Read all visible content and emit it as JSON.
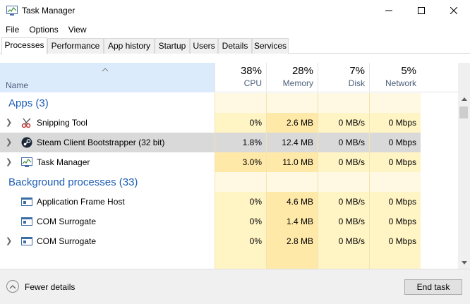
{
  "window": {
    "title": "Task Manager",
    "controls": {
      "minimize": "minimize-icon",
      "maximize": "maximize-icon",
      "close": "close-icon"
    }
  },
  "menu": [
    "File",
    "Options",
    "View"
  ],
  "tabs": [
    "Processes",
    "Performance",
    "App history",
    "Startup",
    "Users",
    "Details",
    "Services"
  ],
  "active_tab": "Processes",
  "header": {
    "name_label": "Name",
    "columns": [
      {
        "pct": "38%",
        "label": "CPU"
      },
      {
        "pct": "28%",
        "label": "Memory"
      },
      {
        "pct": "7%",
        "label": "Disk"
      },
      {
        "pct": "5%",
        "label": "Network"
      }
    ]
  },
  "groups": {
    "apps": "Apps (3)",
    "background": "Background processes (33)"
  },
  "apps": [
    {
      "name": "Snipping Tool",
      "icon": "scissors-icon",
      "cpu": "0%",
      "mem": "2.6 MB",
      "disk": "0 MB/s",
      "net": "0 Mbps",
      "expandable": true
    },
    {
      "name": "Steam Client Bootstrapper (32 bit)",
      "icon": "steam-icon",
      "cpu": "1.8%",
      "mem": "12.4 MB",
      "disk": "0 MB/s",
      "net": "0 Mbps",
      "expandable": true,
      "selected": true
    },
    {
      "name": "Task Manager",
      "icon": "task-manager-icon",
      "cpu": "3.0%",
      "mem": "11.0 MB",
      "disk": "0 MB/s",
      "net": "0 Mbps",
      "expandable": true
    }
  ],
  "background": [
    {
      "name": "Application Frame Host",
      "icon": "window-process-icon",
      "cpu": "0%",
      "mem": "4.6 MB",
      "disk": "0 MB/s",
      "net": "0 Mbps",
      "expandable": false
    },
    {
      "name": "COM Surrogate",
      "icon": "window-process-icon",
      "cpu": "0%",
      "mem": "1.4 MB",
      "disk": "0 MB/s",
      "net": "0 Mbps",
      "expandable": false
    },
    {
      "name": "COM Surrogate",
      "icon": "window-process-icon",
      "cpu": "0%",
      "mem": "2.8 MB",
      "disk": "0 MB/s",
      "net": "0 Mbps",
      "expandable": true
    }
  ],
  "footer": {
    "fewer_details": "Fewer details",
    "end_task": "End task"
  },
  "colors": {
    "accent_blue": "#1c5db4",
    "header_blue": "#dcebfc",
    "heat_light": "#fff4c4",
    "heat_medium": "#ffe9a8",
    "selected_row": "#d9d9d9"
  }
}
